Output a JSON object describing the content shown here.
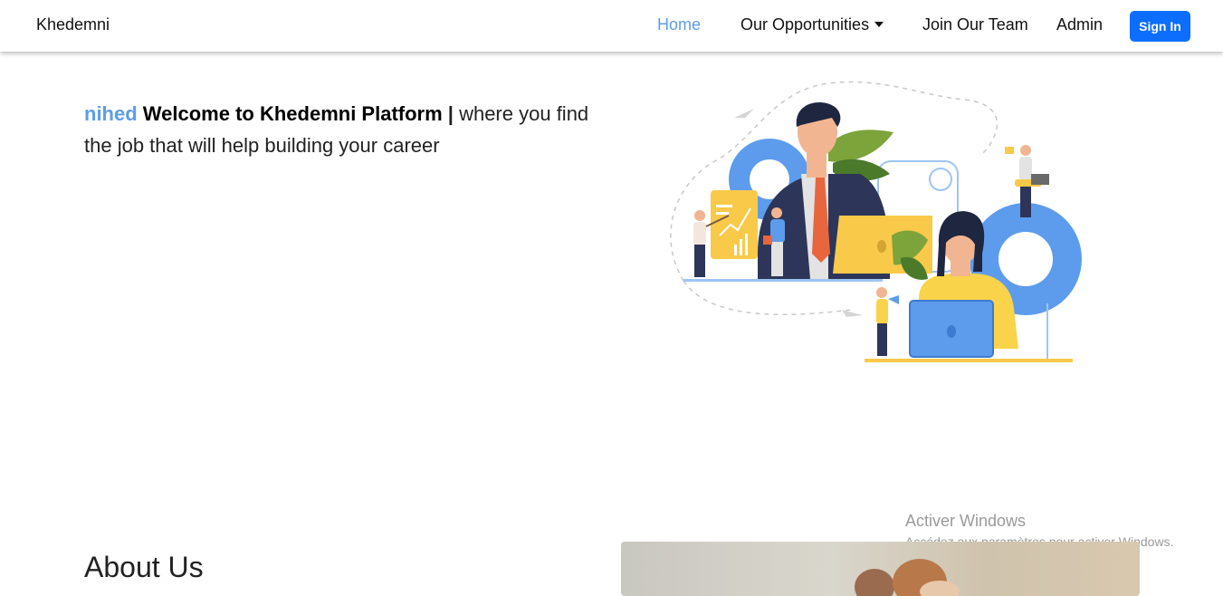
{
  "navbar": {
    "brand": "Khedemni",
    "links": [
      {
        "label": "Home",
        "active": true
      },
      {
        "label": "Our Opportunities",
        "dropdown": true
      },
      {
        "label": "Join Our Team"
      },
      {
        "label": "Admin"
      }
    ],
    "signin_label": "Sign In"
  },
  "hero": {
    "username": "nihed",
    "welcome": "Welcome to Khedemni Platform",
    "separator": "|",
    "tagline": "where you find the job that will help building your career"
  },
  "about": {
    "title": "About Us"
  },
  "windows_activation": {
    "title": "Activer Windows",
    "subtitle": "Accédez aux paramètres pour activer Windows."
  },
  "colors": {
    "accent": "#5d9cec",
    "primary_button": "#0d6efd"
  }
}
